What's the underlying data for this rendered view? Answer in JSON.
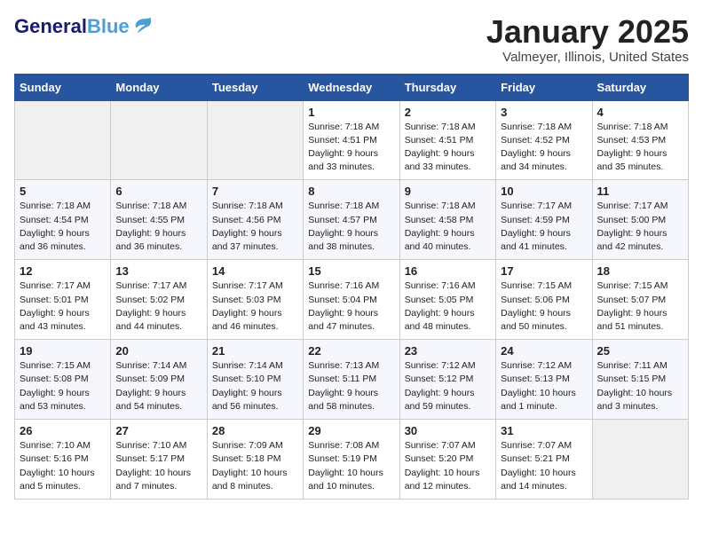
{
  "logo": {
    "part1": "General",
    "part2": "Blue"
  },
  "title": "January 2025",
  "location": "Valmeyer, Illinois, United States",
  "weekdays": [
    "Sunday",
    "Monday",
    "Tuesday",
    "Wednesday",
    "Thursday",
    "Friday",
    "Saturday"
  ],
  "weeks": [
    [
      {
        "day": "",
        "detail": ""
      },
      {
        "day": "",
        "detail": ""
      },
      {
        "day": "",
        "detail": ""
      },
      {
        "day": "1",
        "detail": "Sunrise: 7:18 AM\nSunset: 4:51 PM\nDaylight: 9 hours and 33 minutes."
      },
      {
        "day": "2",
        "detail": "Sunrise: 7:18 AM\nSunset: 4:51 PM\nDaylight: 9 hours and 33 minutes."
      },
      {
        "day": "3",
        "detail": "Sunrise: 7:18 AM\nSunset: 4:52 PM\nDaylight: 9 hours and 34 minutes."
      },
      {
        "day": "4",
        "detail": "Sunrise: 7:18 AM\nSunset: 4:53 PM\nDaylight: 9 hours and 35 minutes."
      }
    ],
    [
      {
        "day": "5",
        "detail": "Sunrise: 7:18 AM\nSunset: 4:54 PM\nDaylight: 9 hours and 36 minutes."
      },
      {
        "day": "6",
        "detail": "Sunrise: 7:18 AM\nSunset: 4:55 PM\nDaylight: 9 hours and 36 minutes."
      },
      {
        "day": "7",
        "detail": "Sunrise: 7:18 AM\nSunset: 4:56 PM\nDaylight: 9 hours and 37 minutes."
      },
      {
        "day": "8",
        "detail": "Sunrise: 7:18 AM\nSunset: 4:57 PM\nDaylight: 9 hours and 38 minutes."
      },
      {
        "day": "9",
        "detail": "Sunrise: 7:18 AM\nSunset: 4:58 PM\nDaylight: 9 hours and 40 minutes."
      },
      {
        "day": "10",
        "detail": "Sunrise: 7:17 AM\nSunset: 4:59 PM\nDaylight: 9 hours and 41 minutes."
      },
      {
        "day": "11",
        "detail": "Sunrise: 7:17 AM\nSunset: 5:00 PM\nDaylight: 9 hours and 42 minutes."
      }
    ],
    [
      {
        "day": "12",
        "detail": "Sunrise: 7:17 AM\nSunset: 5:01 PM\nDaylight: 9 hours and 43 minutes."
      },
      {
        "day": "13",
        "detail": "Sunrise: 7:17 AM\nSunset: 5:02 PM\nDaylight: 9 hours and 44 minutes."
      },
      {
        "day": "14",
        "detail": "Sunrise: 7:17 AM\nSunset: 5:03 PM\nDaylight: 9 hours and 46 minutes."
      },
      {
        "day": "15",
        "detail": "Sunrise: 7:16 AM\nSunset: 5:04 PM\nDaylight: 9 hours and 47 minutes."
      },
      {
        "day": "16",
        "detail": "Sunrise: 7:16 AM\nSunset: 5:05 PM\nDaylight: 9 hours and 48 minutes."
      },
      {
        "day": "17",
        "detail": "Sunrise: 7:15 AM\nSunset: 5:06 PM\nDaylight: 9 hours and 50 minutes."
      },
      {
        "day": "18",
        "detail": "Sunrise: 7:15 AM\nSunset: 5:07 PM\nDaylight: 9 hours and 51 minutes."
      }
    ],
    [
      {
        "day": "19",
        "detail": "Sunrise: 7:15 AM\nSunset: 5:08 PM\nDaylight: 9 hours and 53 minutes."
      },
      {
        "day": "20",
        "detail": "Sunrise: 7:14 AM\nSunset: 5:09 PM\nDaylight: 9 hours and 54 minutes."
      },
      {
        "day": "21",
        "detail": "Sunrise: 7:14 AM\nSunset: 5:10 PM\nDaylight: 9 hours and 56 minutes."
      },
      {
        "day": "22",
        "detail": "Sunrise: 7:13 AM\nSunset: 5:11 PM\nDaylight: 9 hours and 58 minutes."
      },
      {
        "day": "23",
        "detail": "Sunrise: 7:12 AM\nSunset: 5:12 PM\nDaylight: 9 hours and 59 minutes."
      },
      {
        "day": "24",
        "detail": "Sunrise: 7:12 AM\nSunset: 5:13 PM\nDaylight: 10 hours and 1 minute."
      },
      {
        "day": "25",
        "detail": "Sunrise: 7:11 AM\nSunset: 5:15 PM\nDaylight: 10 hours and 3 minutes."
      }
    ],
    [
      {
        "day": "26",
        "detail": "Sunrise: 7:10 AM\nSunset: 5:16 PM\nDaylight: 10 hours and 5 minutes."
      },
      {
        "day": "27",
        "detail": "Sunrise: 7:10 AM\nSunset: 5:17 PM\nDaylight: 10 hours and 7 minutes."
      },
      {
        "day": "28",
        "detail": "Sunrise: 7:09 AM\nSunset: 5:18 PM\nDaylight: 10 hours and 8 minutes."
      },
      {
        "day": "29",
        "detail": "Sunrise: 7:08 AM\nSunset: 5:19 PM\nDaylight: 10 hours and 10 minutes."
      },
      {
        "day": "30",
        "detail": "Sunrise: 7:07 AM\nSunset: 5:20 PM\nDaylight: 10 hours and 12 minutes."
      },
      {
        "day": "31",
        "detail": "Sunrise: 7:07 AM\nSunset: 5:21 PM\nDaylight: 10 hours and 14 minutes."
      },
      {
        "day": "",
        "detail": ""
      }
    ]
  ]
}
